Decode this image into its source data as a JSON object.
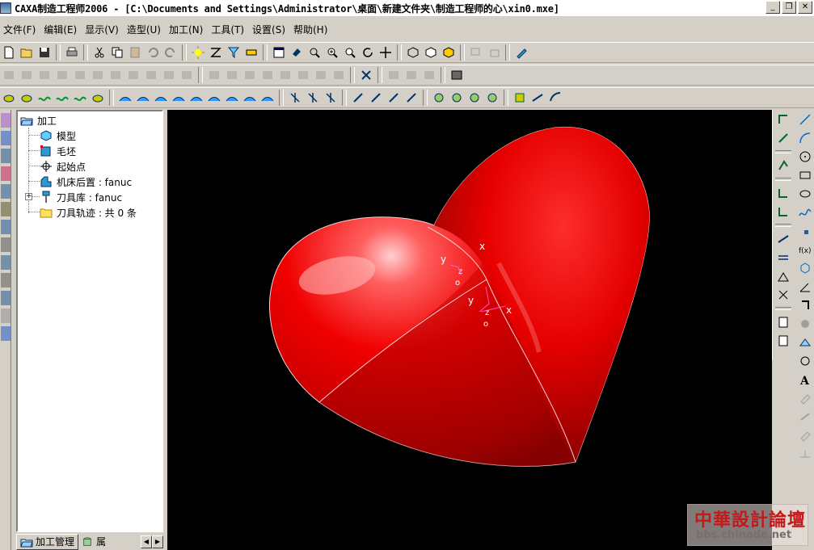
{
  "window": {
    "title": "CAXA制造工程师2006  - [C:\\Documents and Settings\\Administrator\\桌面\\新建文件夹\\制造工程师的心\\xin0.mxe]",
    "min_label": "_",
    "restore_label": "❐",
    "close_label": "✕"
  },
  "menu": [
    "文件(F)",
    "编辑(E)",
    "显示(V)",
    "造型(U)",
    "加工(N)",
    "工具(T)",
    "设置(S)",
    "帮助(H)"
  ],
  "tree": {
    "root": "加工",
    "items": [
      "模型",
      "毛坯",
      "起始点",
      "机床后置 : fanuc",
      "刀具库 : fanuc",
      "刀具轨迹 : 共 0 条"
    ],
    "expander_label": "+"
  },
  "tabs": {
    "manage": "加工管理",
    "attr": "属",
    "prev": "◀",
    "next": "▶"
  },
  "viewport": {
    "background": "#000000",
    "model_color": "#e60000",
    "axis_labels": [
      "y",
      "z",
      "o",
      "x",
      "y",
      "z",
      "o",
      "x"
    ]
  },
  "watermark": {
    "cn": "中華設計論壇",
    "url": "bbs.chinade.net"
  },
  "colors": {
    "chrome": "#d4d0c8",
    "tree_bg": "#ffffff",
    "watermark_red": "#c2191c"
  }
}
